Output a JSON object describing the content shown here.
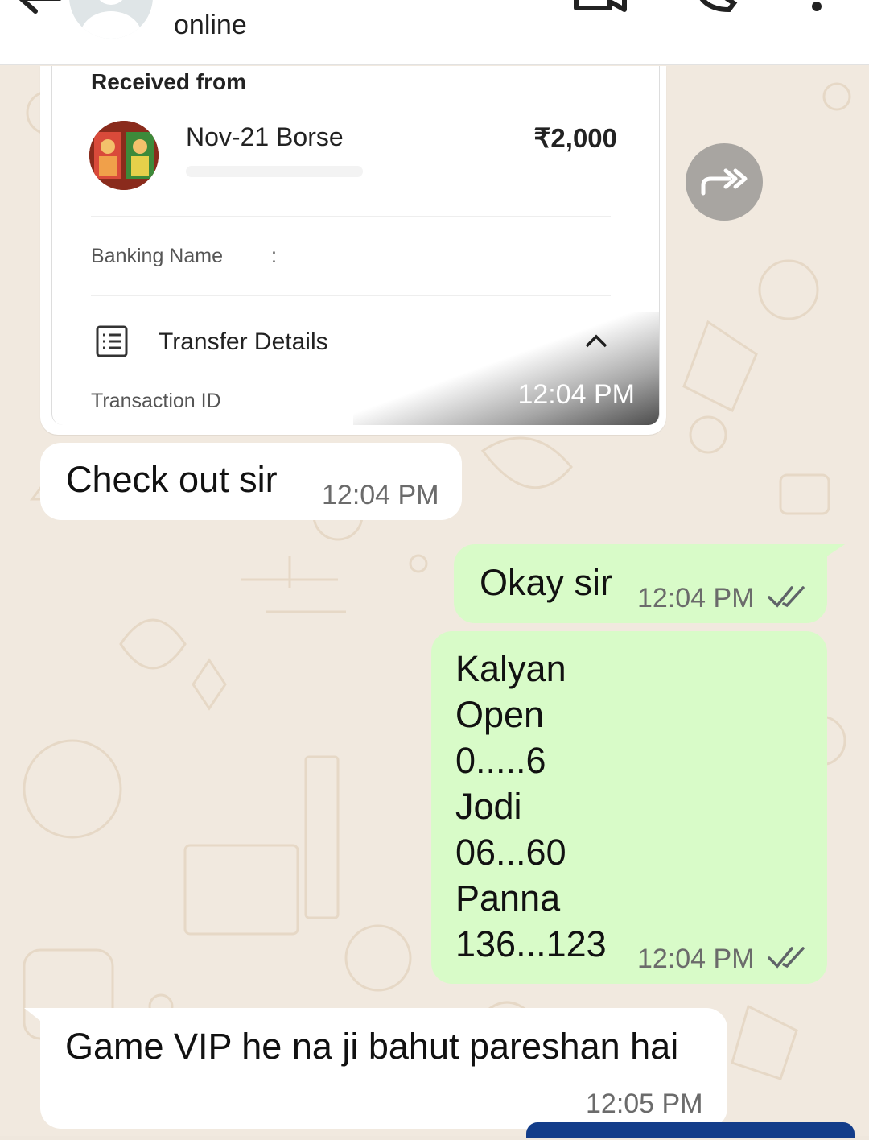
{
  "header": {
    "status": "online"
  },
  "payment_card": {
    "received_from_label": "Received from",
    "payer_name": "Nov-21 Borse",
    "amount": "₹2,000",
    "banking_name_label": "Banking Name",
    "banking_colon": ":",
    "transfer_details_label": "Transfer Details",
    "transaction_id_label": "Transaction ID",
    "time": "12:04 PM"
  },
  "messages": [
    {
      "direction": "incoming",
      "text": "Check out sir",
      "time": "12:04 PM"
    },
    {
      "direction": "outgoing",
      "text": "Okay sir",
      "time": "12:04 PM",
      "status": "read"
    },
    {
      "direction": "outgoing",
      "lines": [
        "Kalyan",
        "Open",
        "0.....6",
        "Jodi",
        "06...60",
        "Panna",
        "136...123"
      ],
      "time": "12:04 PM",
      "status": "read"
    },
    {
      "direction": "incoming",
      "text": "Game VIP he na ji bahut pareshan hai",
      "time": "12:05 PM"
    }
  ],
  "colors": {
    "incoming_bubble": "#ffffff",
    "outgoing_bubble": "#d8fbc8",
    "wallpaper": "#f1e9df",
    "read_ticks": "#5f6368"
  },
  "icons": [
    "back-arrow-icon",
    "video-call-icon",
    "phone-icon",
    "more-vert-icon",
    "forward-icon",
    "list-details-icon",
    "chevron-up-icon",
    "double-check-icon"
  ]
}
